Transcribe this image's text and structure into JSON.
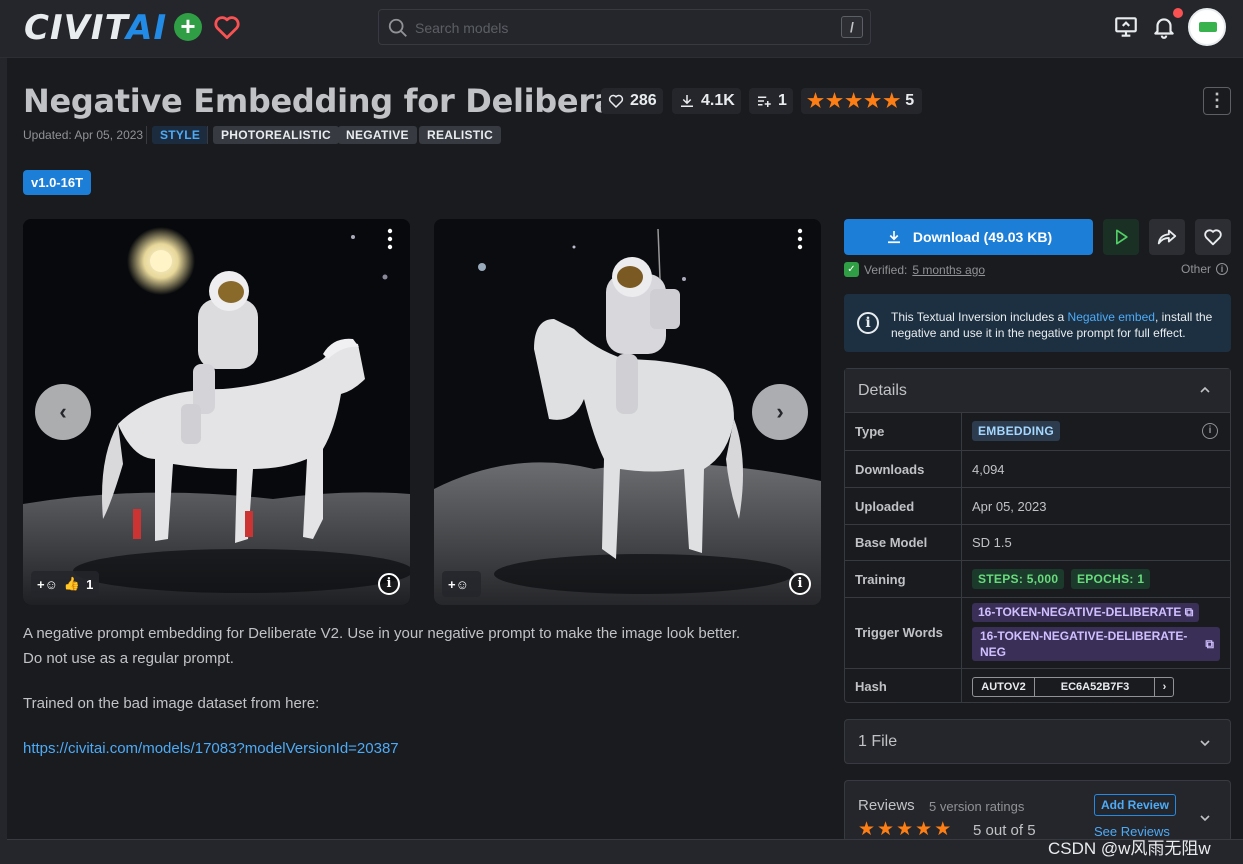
{
  "header": {
    "logo_main": "CIVIT",
    "logo_ai": "AI",
    "search_placeholder": "Search models",
    "search_shortcut": "/"
  },
  "model": {
    "title": "Negative Embedding for Deliberate",
    "likes": "286",
    "downloads": "4.1K",
    "collections": "1",
    "rating": "5",
    "updated": "Updated: Apr 05, 2023",
    "tags": [
      "STYLE",
      "PHOTOREALISTIC",
      "NEGATIVE",
      "REALISTIC"
    ],
    "version": "v1.0-16T"
  },
  "images": [
    {
      "reaction_count": "1"
    },
    {
      "reaction_count": ""
    }
  ],
  "description": {
    "p1_line1": "A negative prompt embedding for Deliberate V2. Use in your negative prompt to make the image look better.",
    "p1_line2": "Do not use as a regular prompt.",
    "p2": "Trained on the bad image dataset from here:",
    "link": "https://civitai.com/models/17083?modelVersionId=20387"
  },
  "actions": {
    "download_label": "Download (49.03 KB)",
    "verified_label": "Verified:",
    "verified_time": "5 months ago",
    "other_label": "Other"
  },
  "alert": {
    "text_before": "This Textual Inversion includes a ",
    "link_text": "Negative embed",
    "text_after": ", install the negative and use it in the negative prompt for full effect."
  },
  "details": {
    "heading": "Details",
    "rows": {
      "type_label": "Type",
      "type_value": "EMBEDDING",
      "downloads_label": "Downloads",
      "downloads_value": "4,094",
      "uploaded_label": "Uploaded",
      "uploaded_value": "Apr 05, 2023",
      "base_label": "Base Model",
      "base_value": "SD 1.5",
      "training_label": "Training",
      "steps": "STEPS: 5,000",
      "epochs": "EPOCHS: 1",
      "trigger_label": "Trigger Words",
      "trigger1": "16-TOKEN-NEGATIVE-DELIBERATE",
      "trigger2a": "16-TOKEN-NEGATIVE-DELIBERATE-",
      "trigger2b": "NEG",
      "hash_label": "Hash",
      "hash_algo": "AUTOV2",
      "hash_value": "EC6A52B7F3"
    }
  },
  "files": {
    "heading": "1 File"
  },
  "reviews": {
    "heading": "Reviews",
    "count": "5 version ratings",
    "add_review": "Add Review",
    "score": "5 out of 5",
    "see_reviews": "See Reviews"
  },
  "watermark": "CSDN @w风雨无阻w",
  "colors": {
    "accent": "#1c7ed6",
    "star": "#fd7e14",
    "verified": "#2f9e44",
    "notification": "#fa5252"
  }
}
